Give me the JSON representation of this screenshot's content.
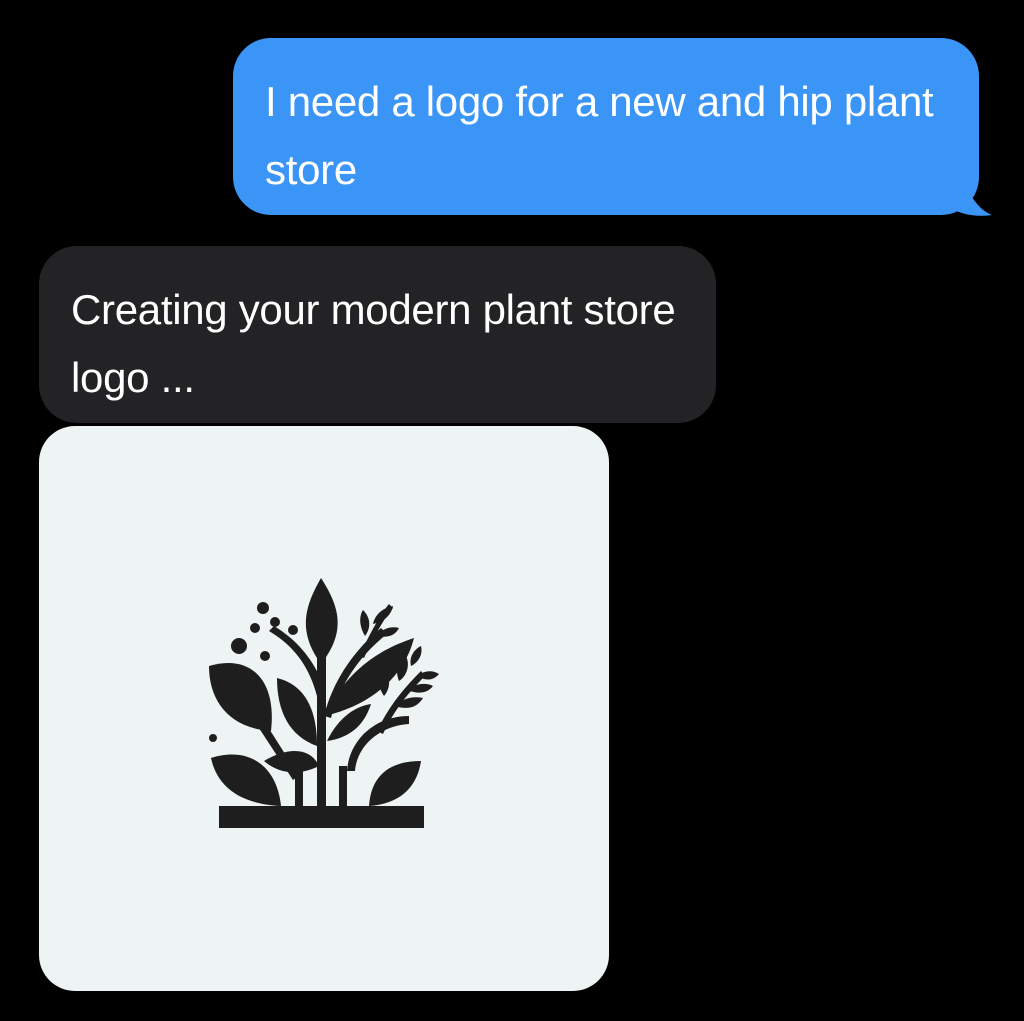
{
  "messages": {
    "outgoing": {
      "text": "I need a logo for a new and hip plant store"
    },
    "incoming": {
      "text": "Creating your modern plant store logo ..."
    }
  },
  "image_attachment": {
    "icon": "plant-logo-icon",
    "background": "#eef3f4",
    "ink": "#1e1e1e"
  },
  "colors": {
    "outgoing_bubble": "#3b95f7",
    "incoming_bubble": "#232325",
    "background": "#000000"
  }
}
